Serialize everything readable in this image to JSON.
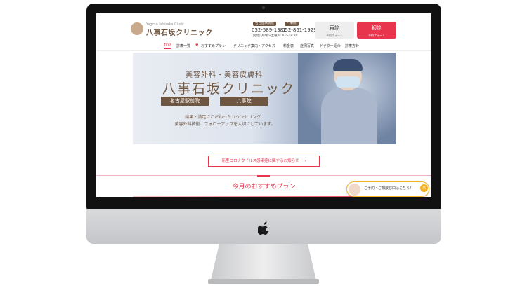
{
  "header": {
    "logo_sub": "Yagoto Ishizaka Clinic",
    "logo_main": "八事石坂クリニック",
    "branch1_tag": "名古屋駅前院",
    "branch1_phone": "052-589-1382",
    "branch2_tag": "八事院",
    "branch2_phone": "052-861-1929",
    "hours": "[受付] 月曜〜土曜 9:30〜18:30",
    "revisit_label": "再診",
    "revisit_sub": "予約フォーム",
    "first_label": "初診",
    "first_sub": "予約フォーム"
  },
  "nav": {
    "items": [
      "TOP",
      "診療一覧",
      "おすすめプラン",
      "クリニック案内・アクセス",
      "料金表",
      "症例写真",
      "ドクター紹介",
      "診療方針"
    ]
  },
  "hero": {
    "title1": "美容外科・美容皮膚科",
    "title2": "八事石坂クリニック",
    "tag1": "名古屋駅前院",
    "tag2": "八事院",
    "desc1": "結果・満足にこだわったカウンセリング、",
    "desc2": "美容外科技術、フォローアップを大切にしています。"
  },
  "notice": {
    "label": "新型コロナウイルス感染症に関するお知らせ",
    "arrow": "›"
  },
  "plan": {
    "title": "今月のおすすめプラン"
  },
  "chat": {
    "text": "ご予約・ご相談窓口はこちら！",
    "close": "×"
  },
  "colors": {
    "accent": "#e9344e",
    "brand_brown": "#6f5641",
    "chat_border": "#f3b323"
  },
  "icons": [
    "apple-logo-icon",
    "heart-icon",
    "chevron-right-icon",
    "close-icon"
  ]
}
